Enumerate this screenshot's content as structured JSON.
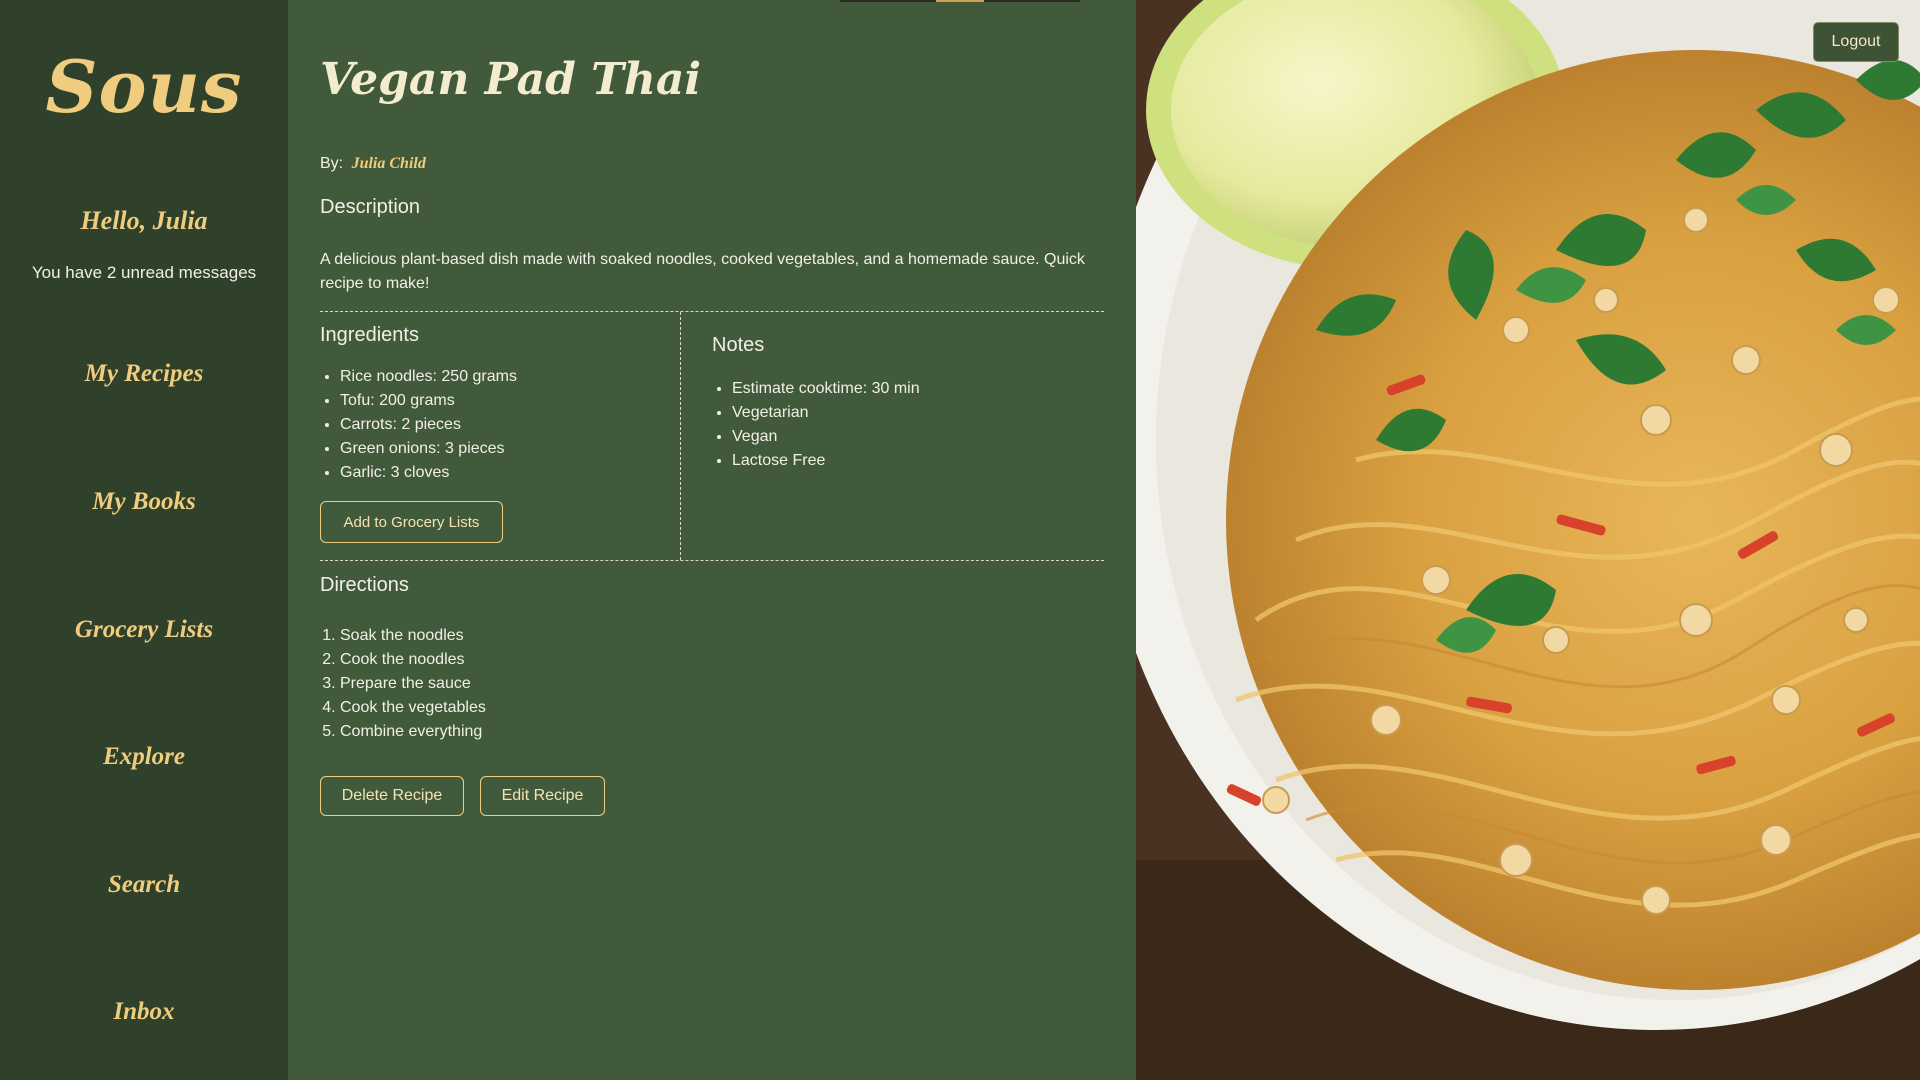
{
  "sidebar": {
    "logo": "Sous",
    "greeting": "Hello, Julia",
    "unread_message": "You have 2 unread messages",
    "items": [
      {
        "label": "My Recipes"
      },
      {
        "label": "My Books"
      },
      {
        "label": "Grocery Lists"
      },
      {
        "label": "Explore"
      },
      {
        "label": "Search"
      },
      {
        "label": "Inbox"
      }
    ]
  },
  "recipe": {
    "title": "Vegan Pad Thai",
    "by_label": "By:",
    "author": "Julia Child",
    "description_heading": "Description",
    "description": "A delicious plant-based dish made with soaked noodles, cooked vegetables, and a homemade sauce. Quick recipe to make!",
    "ingredients_heading": "Ingredients",
    "ingredients": [
      "Rice noodles: 250 grams",
      "Tofu: 200 grams",
      "Carrots: 2 pieces",
      "Green onions: 3 pieces",
      "Garlic: 3 cloves"
    ],
    "add_to_grocery_label": "Add to Grocery Lists",
    "notes_heading": "Notes",
    "notes": [
      "Estimate cooktime: 30 min",
      "Vegetarian",
      "Vegan",
      "Lactose Free"
    ],
    "directions_heading": "Directions",
    "directions": [
      "Soak the noodles",
      "Cook the noodles",
      "Prepare the sauce",
      "Cook the vegetables",
      "Combine everything"
    ],
    "delete_label": "Delete Recipe",
    "edit_label": "Edit Recipe"
  },
  "header": {
    "logout_label": "Logout"
  },
  "colors": {
    "sidebar_bg": "#2f412b",
    "main_bg": "#425a3c",
    "accent_gold": "#f0cd7e"
  }
}
